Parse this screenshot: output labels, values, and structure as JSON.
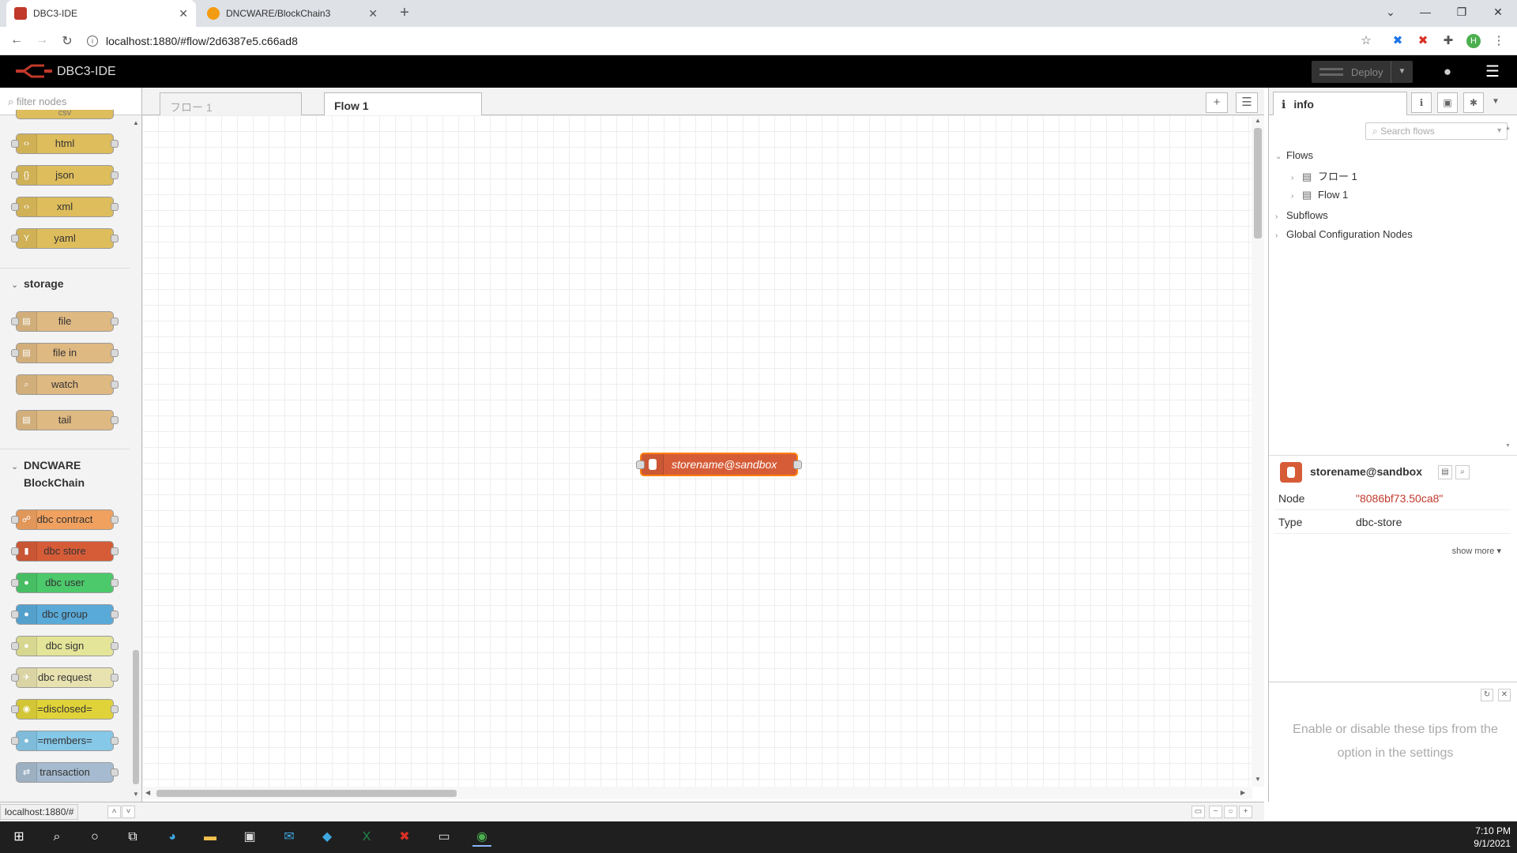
{
  "browser": {
    "tabs": [
      {
        "title": "DBC3-IDE",
        "active": true,
        "favicon_color": "#c0392b"
      },
      {
        "title": "DNCWARE/BlockChain3",
        "active": false,
        "favicon_color": "#f39c12"
      }
    ],
    "url": "localhost:1880/#flow/2d6387e5.c66ad8",
    "profile_initial": "H"
  },
  "app": {
    "title": "DBC3-IDE",
    "deploy_label": "Deploy"
  },
  "palette": {
    "filter_placeholder": "filter nodes",
    "top_partial": "csv",
    "parser_nodes": [
      {
        "label": "html",
        "glyph": "‹›",
        "color": "#debd5c"
      },
      {
        "label": "json",
        "glyph": "{}",
        "color": "#debd5c"
      },
      {
        "label": "xml",
        "glyph": "‹›",
        "color": "#debd5c"
      },
      {
        "label": "yaml",
        "glyph": "Y",
        "color": "#debd5c"
      }
    ],
    "storage_title": "storage",
    "storage_nodes": [
      {
        "label": "file",
        "glyph": "▤",
        "color": "#dfb982"
      },
      {
        "label": "file in",
        "glyph": "▤",
        "color": "#dfb982"
      },
      {
        "label": "watch",
        "glyph": "⌕",
        "color": "#dfb982"
      },
      {
        "label": "tail",
        "glyph": "▤",
        "color": "#dfb982"
      }
    ],
    "dncware_title_line1": "DNCWARE",
    "dncware_title_line2": "BlockChain",
    "dncware_nodes": [
      {
        "label": "dbc contract",
        "glyph": "☍",
        "color": "#f0a15f"
      },
      {
        "label": "dbc store",
        "glyph": "▮",
        "color": "#d65c38"
      },
      {
        "label": "dbc user",
        "glyph": "●",
        "color": "#4cc96b"
      },
      {
        "label": "dbc group",
        "glyph": "●",
        "color": "#5aaad9"
      },
      {
        "label": "dbc sign",
        "glyph": "●",
        "color": "#e5e59a"
      },
      {
        "label": "dbc request",
        "glyph": "✈",
        "color": "#e8e2b0"
      },
      {
        "label": "=disclosed=",
        "glyph": "◉",
        "color": "#e0d33a"
      },
      {
        "label": "=members=",
        "glyph": "●",
        "color": "#86c8e8"
      },
      {
        "label": "transaction",
        "glyph": "⇄",
        "color": "#a6bbcf"
      }
    ]
  },
  "workspace": {
    "tabs": [
      {
        "label": "フロー 1",
        "active": false
      },
      {
        "label": "Flow 1",
        "active": true
      }
    ],
    "canvas_node": {
      "label": "storename@sandbox",
      "color": "#d65c38"
    },
    "status_url": "localhost:1880/#"
  },
  "sidebar": {
    "tab_label": "info",
    "search_placeholder": "Search flows",
    "tree": {
      "flows_label": "Flows",
      "flows": [
        "フロー 1",
        "Flow 1"
      ],
      "subflows_label": "Subflows",
      "global_label": "Global Configuration Nodes"
    },
    "selected_title": "storename@sandbox",
    "props": [
      {
        "key": "Node",
        "value": "\"8086bf73.50ca8\"",
        "value_color": "#c0392b"
      },
      {
        "key": "Type",
        "value": "dbc-store",
        "value_color": "#333333"
      }
    ],
    "show_more": "show more ▾",
    "tip_text": "Enable or disable these tips from the option in the settings"
  },
  "taskbar": {
    "time": "7:10 PM",
    "date": "9/1/2021"
  }
}
